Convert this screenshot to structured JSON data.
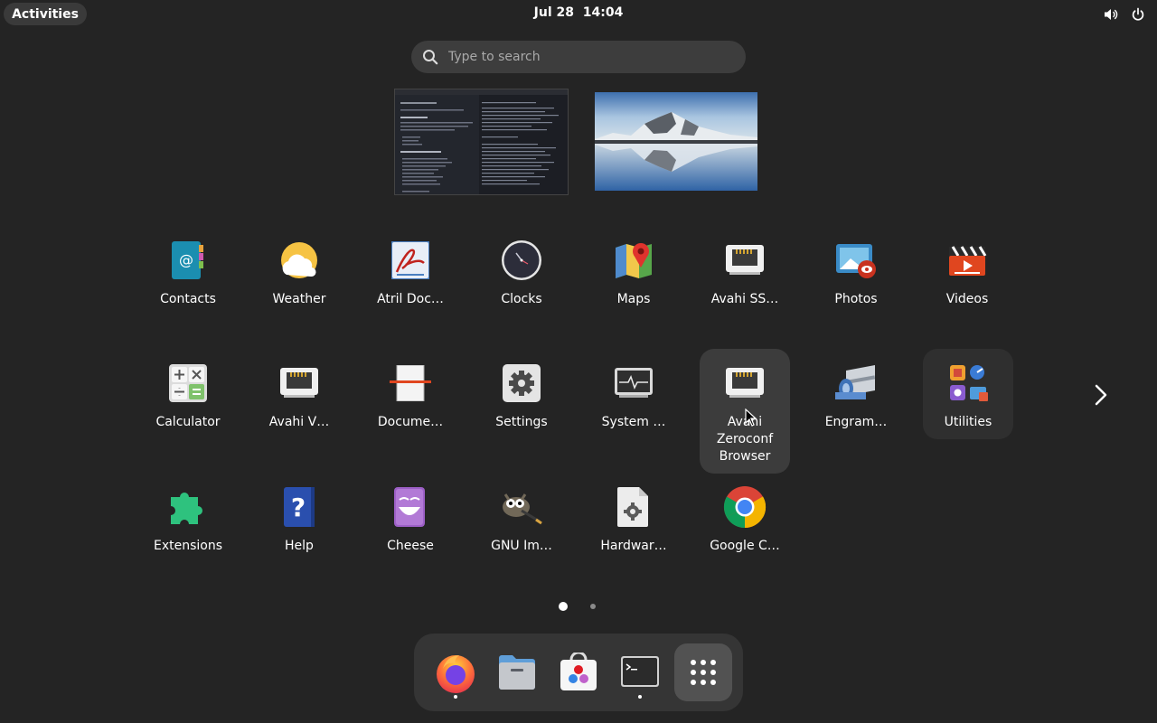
{
  "topbar": {
    "activities_label": "Activities",
    "date": "Jul 28",
    "time": "14:04",
    "volume_icon": "volume-icon",
    "power_icon": "power-icon"
  },
  "search": {
    "placeholder": "Type to search",
    "value": ""
  },
  "workspaces": [
    {
      "name": "workspace-1",
      "content": "terminal-and-document"
    },
    {
      "name": "workspace-2",
      "content": "mountain-lake-wallpaper"
    }
  ],
  "apps": [
    {
      "label": "Contacts",
      "icon": "contacts-icon"
    },
    {
      "label": "Weather",
      "icon": "weather-icon"
    },
    {
      "label": "Atril Doc…",
      "icon": "atril-icon"
    },
    {
      "label": "Clocks",
      "icon": "clocks-icon"
    },
    {
      "label": "Maps",
      "icon": "maps-icon"
    },
    {
      "label": "Avahi SS…",
      "icon": "network-icon"
    },
    {
      "label": "Photos",
      "icon": "photos-icon"
    },
    {
      "label": "Videos",
      "icon": "videos-icon"
    },
    {
      "label": "Calculator",
      "icon": "calculator-icon"
    },
    {
      "label": "Avahi V…",
      "icon": "network-icon"
    },
    {
      "label": "Docume…",
      "icon": "document-scanner-icon"
    },
    {
      "label": "Settings",
      "icon": "settings-icon"
    },
    {
      "label": "System …",
      "icon": "system-monitor-icon"
    },
    {
      "label": "Avahi Zeroconf Browser",
      "icon": "network-icon"
    },
    {
      "label": "Engram…",
      "icon": "engrampa-icon"
    },
    {
      "label": "Utilities",
      "icon": "folder-icon"
    },
    {
      "label": "Extensions",
      "icon": "extensions-icon"
    },
    {
      "label": "Help",
      "icon": "help-icon"
    },
    {
      "label": "Cheese",
      "icon": "cheese-icon"
    },
    {
      "label": "GNU Im…",
      "icon": "gimp-icon"
    },
    {
      "label": "Hardwar…",
      "icon": "hardware-icon"
    },
    {
      "label": "Google C…",
      "icon": "chrome-icon"
    }
  ],
  "pagination": {
    "current": 1,
    "total": 2
  },
  "dock": [
    {
      "name": "firefox",
      "icon": "firefox-icon",
      "running": true
    },
    {
      "name": "files",
      "icon": "files-icon",
      "running": false
    },
    {
      "name": "software",
      "icon": "software-icon",
      "running": false
    },
    {
      "name": "terminal",
      "icon": "terminal-icon",
      "running": true
    },
    {
      "name": "show-apps",
      "icon": "app-grid-icon",
      "running": false
    }
  ],
  "colors": {
    "background": "#242424",
    "hover_tile": "#3c3c3c",
    "dock": "#353535",
    "search": "#3d3d3d"
  }
}
